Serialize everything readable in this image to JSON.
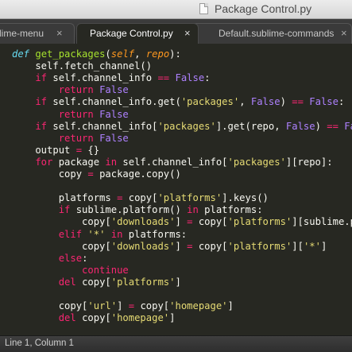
{
  "window": {
    "title": "Package Control.py",
    "icon": "document-icon"
  },
  "tabs": [
    {
      "label": "lime-menu",
      "close": "×",
      "active": false
    },
    {
      "label": "Package Control.py",
      "close": "×",
      "active": true
    },
    {
      "label": "Default.sublime-commands",
      "close": "×",
      "active": false
    }
  ],
  "colors": {
    "background": "#272822",
    "keyword": "#f92672",
    "def": "#66d9ef",
    "function": "#a6e22e",
    "param": "#fd971f",
    "constant": "#ae81ff",
    "string": "#e6db74",
    "plain": "#f8f8f2"
  },
  "code_lines": [
    [
      [
        "df",
        "def "
      ],
      [
        "fn",
        "get_packages"
      ],
      [
        "pl",
        "("
      ],
      [
        "pa",
        "self"
      ],
      [
        "pl",
        ", "
      ],
      [
        "pa",
        "repo"
      ],
      [
        "pl",
        "):"
      ]
    ],
    [
      [
        "pl",
        "    self.fetch_channel()"
      ]
    ],
    [
      [
        "kw",
        "    if "
      ],
      [
        "pl",
        "self.channel_info "
      ],
      [
        "kw",
        "=="
      ],
      [
        "pl",
        " "
      ],
      [
        "cn",
        "False"
      ],
      [
        "pl",
        ":"
      ]
    ],
    [
      [
        "kw",
        "        return "
      ],
      [
        "cn",
        "False"
      ]
    ],
    [
      [
        "kw",
        "    if "
      ],
      [
        "pl",
        "self.channel_info.get("
      ],
      [
        "st",
        "'packages'"
      ],
      [
        "pl",
        ", "
      ],
      [
        "cn",
        "False"
      ],
      [
        "pl",
        ") "
      ],
      [
        "kw",
        "=="
      ],
      [
        "pl",
        " "
      ],
      [
        "cn",
        "False"
      ],
      [
        "pl",
        ":"
      ]
    ],
    [
      [
        "kw",
        "        return "
      ],
      [
        "cn",
        "False"
      ]
    ],
    [
      [
        "kw",
        "    if "
      ],
      [
        "pl",
        "self.channel_info["
      ],
      [
        "st",
        "'packages'"
      ],
      [
        "pl",
        "].get(repo, "
      ],
      [
        "cn",
        "False"
      ],
      [
        "pl",
        ") "
      ],
      [
        "kw",
        "=="
      ],
      [
        "pl",
        " "
      ],
      [
        "cn",
        "Fa"
      ]
    ],
    [
      [
        "kw",
        "        return "
      ],
      [
        "cn",
        "False"
      ]
    ],
    [
      [
        "pl",
        "    output "
      ],
      [
        "kw",
        "="
      ],
      [
        "pl",
        " {}"
      ]
    ],
    [
      [
        "kw",
        "    for "
      ],
      [
        "pl",
        "package "
      ],
      [
        "kw",
        "in "
      ],
      [
        "pl",
        "self.channel_info["
      ],
      [
        "st",
        "'packages'"
      ],
      [
        "pl",
        "][repo]:"
      ]
    ],
    [
      [
        "pl",
        "        copy "
      ],
      [
        "kw",
        "="
      ],
      [
        "pl",
        " package.copy()"
      ]
    ],
    [],
    [
      [
        "pl",
        "        platforms "
      ],
      [
        "kw",
        "="
      ],
      [
        "pl",
        " copy["
      ],
      [
        "st",
        "'platforms'"
      ],
      [
        "pl",
        "].keys()"
      ]
    ],
    [
      [
        "kw",
        "        if "
      ],
      [
        "pl",
        "sublime.platform() "
      ],
      [
        "kw",
        "in "
      ],
      [
        "pl",
        "platforms:"
      ]
    ],
    [
      [
        "pl",
        "            copy["
      ],
      [
        "st",
        "'downloads'"
      ],
      [
        "pl",
        "] "
      ],
      [
        "kw",
        "="
      ],
      [
        "pl",
        " copy["
      ],
      [
        "st",
        "'platforms'"
      ],
      [
        "pl",
        "][sublime.p"
      ]
    ],
    [
      [
        "kw",
        "        elif "
      ],
      [
        "st",
        "'*'"
      ],
      [
        "kw",
        " in "
      ],
      [
        "pl",
        "platforms:"
      ]
    ],
    [
      [
        "pl",
        "            copy["
      ],
      [
        "st",
        "'downloads'"
      ],
      [
        "pl",
        "] "
      ],
      [
        "kw",
        "="
      ],
      [
        "pl",
        " copy["
      ],
      [
        "st",
        "'platforms'"
      ],
      [
        "pl",
        "]["
      ],
      [
        "st",
        "'*'"
      ],
      [
        "pl",
        "]"
      ]
    ],
    [
      [
        "kw",
        "        else"
      ],
      [
        "pl",
        ":"
      ]
    ],
    [
      [
        "kw",
        "            continue"
      ]
    ],
    [
      [
        "kw",
        "        del "
      ],
      [
        "pl",
        "copy["
      ],
      [
        "st",
        "'platforms'"
      ],
      [
        "pl",
        "]"
      ]
    ],
    [],
    [
      [
        "pl",
        "        copy["
      ],
      [
        "st",
        "'url'"
      ],
      [
        "pl",
        "] "
      ],
      [
        "kw",
        "="
      ],
      [
        "pl",
        " copy["
      ],
      [
        "st",
        "'homepage'"
      ],
      [
        "pl",
        "]"
      ]
    ],
    [
      [
        "kw",
        "        del "
      ],
      [
        "pl",
        "copy["
      ],
      [
        "st",
        "'homepage'"
      ],
      [
        "pl",
        "]"
      ]
    ]
  ],
  "status": {
    "position": "Line 1, Column 1"
  }
}
